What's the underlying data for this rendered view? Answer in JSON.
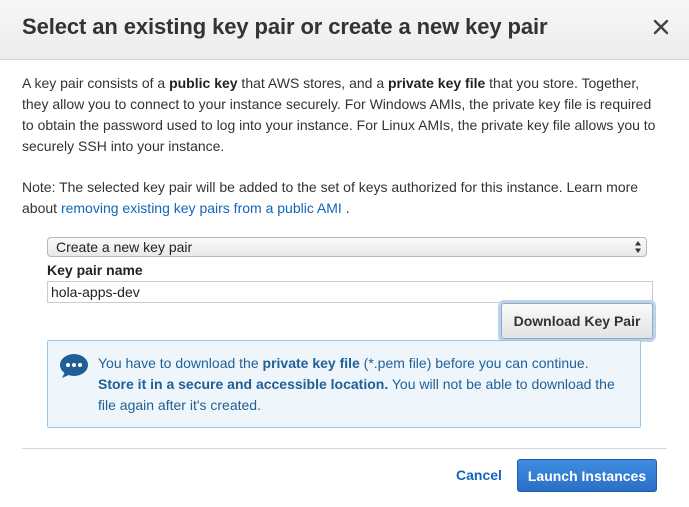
{
  "dialog": {
    "title": "Select an existing key pair or create a new key pair"
  },
  "intro": {
    "t1": "A key pair consists of a ",
    "b1": "public key",
    "t2": " that AWS stores, and a ",
    "b2": "private key file",
    "t3": " that you store. Together, they allow you to connect to your instance securely. For Windows AMIs, the private key file is required to obtain the password used to log into your instance. For Linux AMIs, the private key file allows you to securely SSH into your instance."
  },
  "note": {
    "text": "Note: The selected key pair will be added to the set of keys authorized for this instance. Learn more about ",
    "link": "removing existing key pairs from a public AMI",
    "end": " ."
  },
  "form": {
    "select_value": "Create a new key pair",
    "key_pair_label": "Key pair name",
    "key_pair_value": "hola-apps-dev",
    "download_label": "Download Key Pair"
  },
  "info": {
    "t1": "You have to download the ",
    "b1": "private key file",
    "t2": " (*.pem file) before you can continue. ",
    "b2": "Store it in a secure and accessible location.",
    "t3": " You will not be able to download the file again after it's created."
  },
  "footer": {
    "cancel_label": "Cancel",
    "launch_label": "Launch Instances"
  },
  "colors": {
    "link": "#1166bb",
    "primary": "#2a6fc6",
    "info_bg": "#eef6fc",
    "info_border": "#9cc6e6"
  },
  "icons": {
    "close": "close-icon",
    "info": "chat-bubble-icon",
    "select_arrows": "updown-arrows-icon"
  }
}
